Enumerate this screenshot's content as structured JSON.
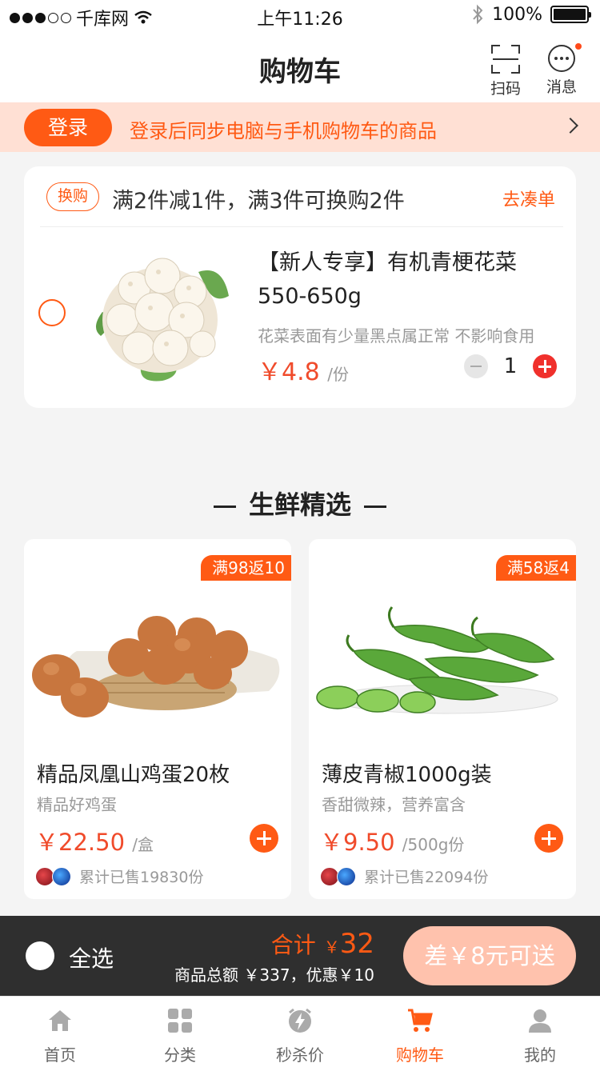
{
  "status": {
    "carrier": "千库网",
    "time": "上午11:26",
    "battery": "100%"
  },
  "nav": {
    "title": "购物车",
    "scan_label": "扫码",
    "message_label": "消息"
  },
  "login_banner": {
    "button": "登录",
    "text": "登录后同步电脑与手机购物车的商品"
  },
  "cart_group": {
    "promo_tag": "换购",
    "promo_text": "满2件减1件，满3件可换购2件",
    "promo_link": "去凑单",
    "item": {
      "title": "【新人专享】有机青梗花菜550-650g",
      "desc": "花菜表面有少量黑点属正常 不影响食用",
      "price": "￥4.8",
      "unit": "/份",
      "quantity": "1",
      "icon": "cauliflower-image"
    }
  },
  "section": {
    "title": "生鲜精选"
  },
  "products": [
    {
      "badge": "满98返10",
      "name": "精品凤凰山鸡蛋20枚",
      "sub": "精品好鸡蛋",
      "price": "￥22.50",
      "unit": "/盒",
      "sold": "累计已售19830份",
      "icon": "eggs-image"
    },
    {
      "badge": "满58返4",
      "name": "薄皮青椒1000g装",
      "sub": "香甜微辣，营养富含",
      "price": "￥9.50",
      "unit": "/500g份",
      "sold": "累计已售22094份",
      "icon": "green-pepper-image"
    }
  ],
  "checkout": {
    "select_all": "全选",
    "total_label": "合计",
    "total_currency": "￥",
    "total_value": "32",
    "summary": "商品总额 ￥337，优惠￥10",
    "button": "差￥8元可送"
  },
  "tabs": [
    {
      "label": "首页",
      "icon": "home-icon"
    },
    {
      "label": "分类",
      "icon": "category-icon"
    },
    {
      "label": "秒杀价",
      "icon": "flash-sale-icon"
    },
    {
      "label": "购物车",
      "icon": "cart-icon",
      "active": true
    },
    {
      "label": "我的",
      "icon": "profile-icon"
    }
  ],
  "colors": {
    "accent": "#ff5a14",
    "price": "#f04b2b",
    "banner_bg": "#ffe0d4",
    "checkout_bg": "#2f2f2f"
  }
}
